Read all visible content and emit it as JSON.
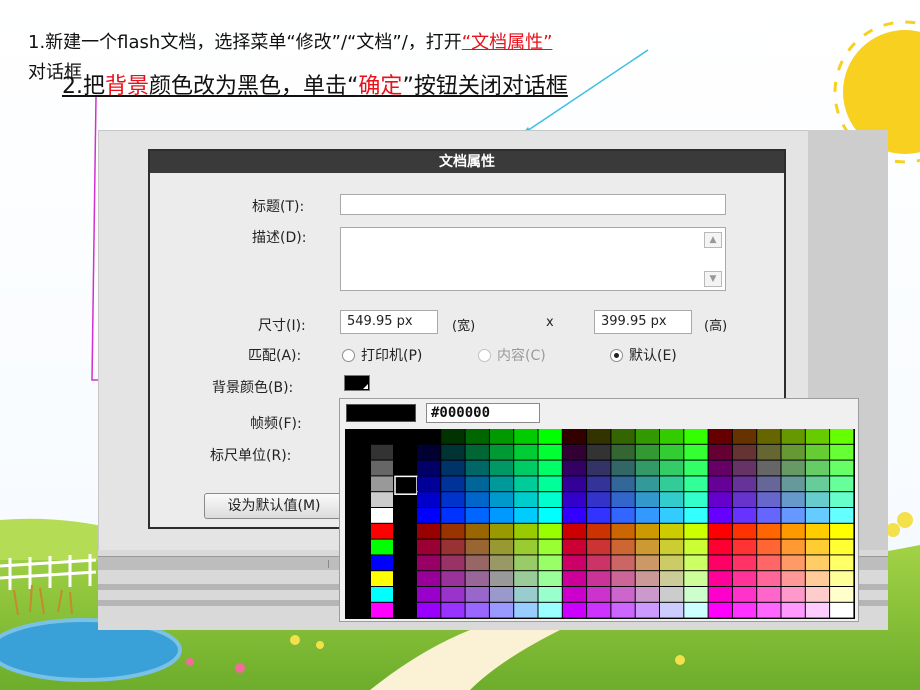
{
  "caption_line1": "1.新建一个flash文档，选择菜单“修改”/“文档”/，打开",
  "caption_line1_highlight": "“文档属性”",
  "caption_line1_end": "对话框",
  "caption_line2_prefix": "2.把",
  "caption_line2_highlight1": "背景",
  "caption_line2_mid": "颜色改为黑色，单击“",
  "caption_line2_highlight2": "确定",
  "caption_line2_suffix": "”按钮关闭对话框",
  "dialog": {
    "title": "文档属性",
    "title_label": "标题(T):",
    "title_value": "",
    "desc_label": "描述(D):",
    "desc_value": "",
    "size_label": "尺寸(I):",
    "width_value": "549.95 px",
    "width_unit": "(宽)",
    "times_sign": "x",
    "height_value": "399.95 px",
    "height_unit": "(高)",
    "match_label": "匹配(A):",
    "match_options": [
      "打印机(P)",
      "内容(C)",
      "默认(E)"
    ],
    "match_selected": "默认(E)",
    "bg_label": "背景颜色(B):",
    "bg_color": "#000000",
    "fps_label": "帧频(F):",
    "ruler_label": "标尺单位(R):",
    "default_button": "设为默认值(M)"
  },
  "picker": {
    "hex_value": "#000000",
    "selected_color": "#000000",
    "grays": [
      "#000000",
      "#333333",
      "#666666",
      "#999999",
      "#cccccc",
      "#ffffff"
    ],
    "basics": [
      "#ff0000",
      "#00ff00",
      "#0000ff",
      "#ffff00",
      "#00ffff",
      "#ff00ff"
    ]
  },
  "colors": {
    "dialog_title_bg": "#3a3a3a",
    "highlight_text": "#e8101a",
    "sky_top": "#ffffff",
    "grass": "#8cc63f"
  }
}
